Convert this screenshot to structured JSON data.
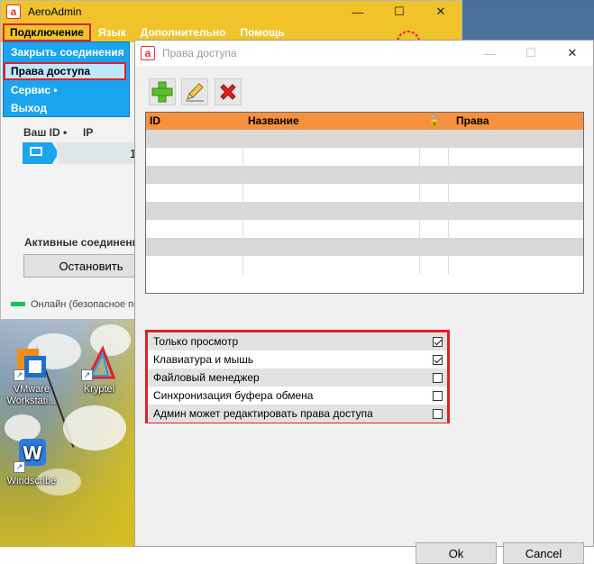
{
  "main_window": {
    "title": "AeroAdmin",
    "menu": [
      "Подключение",
      "Язык",
      "Дополнительно",
      "Помощь"
    ],
    "dropdown": [
      "Закрыть соединения",
      "Права доступа",
      "Сервис •",
      "Выход"
    ],
    "your_id_label": "Ваш ID •",
    "ip_label": "IP",
    "ip_value_partial": "1",
    "active_connections_label": "Активные соединени",
    "stop_button": "Остановить",
    "status_text": "Онлайн (безопасное по"
  },
  "dialog": {
    "title": "Права доступа",
    "columns": [
      "ID",
      "Название",
      "lock-icon",
      "Права"
    ],
    "rows": 8,
    "rights": [
      {
        "label": "Только просмотр",
        "checked": true
      },
      {
        "label": "Клавиатура и мышь",
        "checked": true
      },
      {
        "label": "Файловый менеджер",
        "checked": false
      },
      {
        "label": "Синхронизация буфера обмена",
        "checked": false
      },
      {
        "label": "Админ может редактировать права доступа",
        "checked": false
      }
    ],
    "ok_button": "Ok",
    "cancel_button": "Cancel"
  },
  "desktop_icons": [
    "VMware Workstati...",
    "Kryptel",
    "Windscribe"
  ],
  "colors": {
    "accent": "#f0c32a",
    "menu_blue": "#1aa5ee",
    "header_orange": "#f7913d",
    "highlight_red": "#e0202c"
  }
}
